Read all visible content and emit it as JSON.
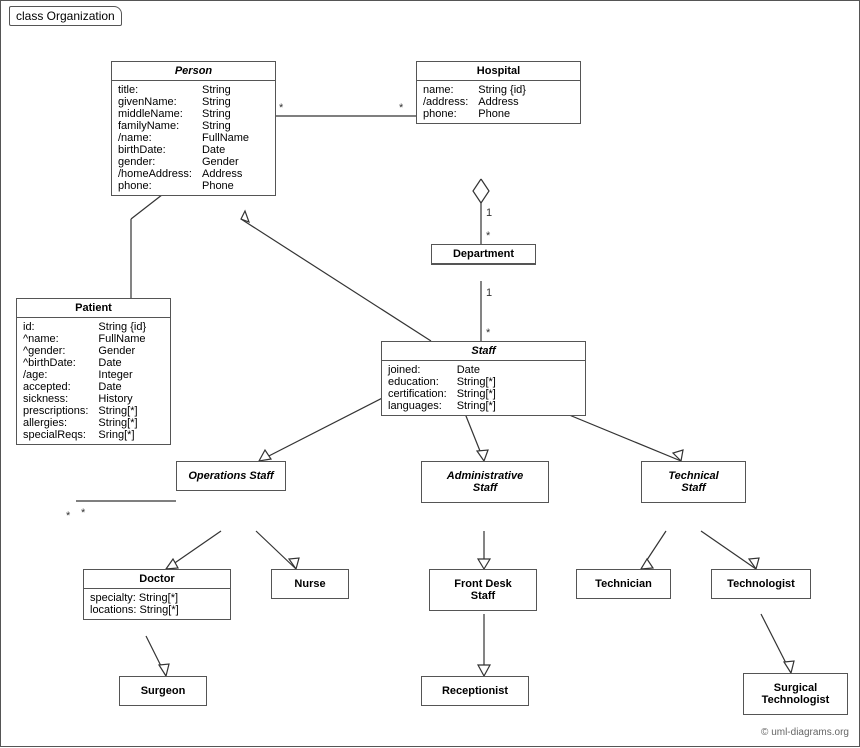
{
  "title": "class Organization",
  "copyright": "© uml-diagrams.org",
  "boxes": {
    "person": {
      "title": "Person",
      "fields": [
        {
          "name": "title:",
          "type": "String"
        },
        {
          "name": "givenName:",
          "type": "String"
        },
        {
          "name": "middleName:",
          "type": "String"
        },
        {
          "name": "familyName:",
          "type": "String"
        },
        {
          "name": "/name:",
          "type": "FullName"
        },
        {
          "name": "birthDate:",
          "type": "Date"
        },
        {
          "name": "gender:",
          "type": "Gender"
        },
        {
          "name": "/homeAddress:",
          "type": "Address"
        },
        {
          "name": "phone:",
          "type": "Phone"
        }
      ]
    },
    "hospital": {
      "title": "Hospital",
      "fields": [
        {
          "name": "name:",
          "type": "String {id}"
        },
        {
          "name": "/address:",
          "type": "Address"
        },
        {
          "name": "phone:",
          "type": "Phone"
        }
      ]
    },
    "patient": {
      "title": "Patient",
      "fields": [
        {
          "name": "id:",
          "type": "String {id}"
        },
        {
          "name": "^name:",
          "type": "FullName"
        },
        {
          "name": "^gender:",
          "type": "Gender"
        },
        {
          "name": "^birthDate:",
          "type": "Date"
        },
        {
          "name": "/age:",
          "type": "Integer"
        },
        {
          "name": "accepted:",
          "type": "Date"
        },
        {
          "name": "sickness:",
          "type": "History"
        },
        {
          "name": "prescriptions:",
          "type": "String[*]"
        },
        {
          "name": "allergies:",
          "type": "String[*]"
        },
        {
          "name": "specialReqs:",
          "type": "Sring[*]"
        }
      ]
    },
    "department": {
      "title": "Department"
    },
    "staff": {
      "title": "Staff",
      "fields": [
        {
          "name": "joined:",
          "type": "Date"
        },
        {
          "name": "education:",
          "type": "String[*]"
        },
        {
          "name": "certification:",
          "type": "String[*]"
        },
        {
          "name": "languages:",
          "type": "String[*]"
        }
      ]
    },
    "ops_staff": {
      "title": "Operations\nStaff",
      "italic": true
    },
    "admin_staff": {
      "title": "Administrative\nStaff",
      "italic": true
    },
    "tech_staff": {
      "title": "Technical\nStaff",
      "italic": true
    },
    "doctor": {
      "title": "Doctor",
      "fields": [
        {
          "name": "specialty:",
          "type": "String[*]"
        },
        {
          "name": "locations:",
          "type": "String[*]"
        }
      ]
    },
    "nurse": {
      "title": "Nurse"
    },
    "front_desk": {
      "title": "Front Desk\nStaff"
    },
    "technician": {
      "title": "Technician"
    },
    "technologist": {
      "title": "Technologist"
    },
    "surgeon": {
      "title": "Surgeon"
    },
    "receptionist": {
      "title": "Receptionist"
    },
    "surgical_tech": {
      "title": "Surgical\nTechnologist"
    }
  }
}
